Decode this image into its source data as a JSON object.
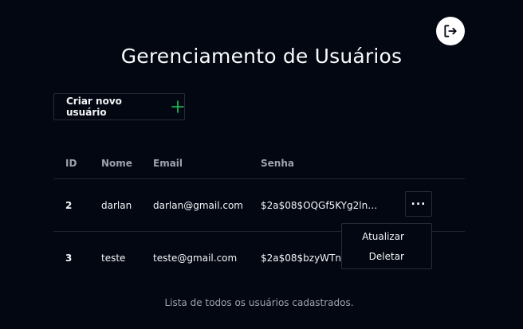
{
  "header": {
    "title": "Gerenciamento de Usuários",
    "logout_icon": "logout-icon"
  },
  "toolbar": {
    "create_label": "Criar novo usuário",
    "create_icon": "plus-icon",
    "accent": "#22c55e"
  },
  "table": {
    "columns": [
      "ID",
      "Nome",
      "Email",
      "Senha"
    ],
    "rows": [
      {
        "id": "2",
        "name": "darlan",
        "email": "darlan@gmail.com",
        "password": "$2a$08$OQGf5KYg2lnK…"
      },
      {
        "id": "3",
        "name": "teste",
        "email": "teste@gmail.com",
        "password": "$2a$08$bzyWTnM"
      }
    ],
    "caption": "Lista de todos os usuários cadastrados.",
    "row_menu_icon": "more-horizontal-icon"
  },
  "dropdown": {
    "items": [
      "Atualizar",
      "Deletar"
    ]
  }
}
